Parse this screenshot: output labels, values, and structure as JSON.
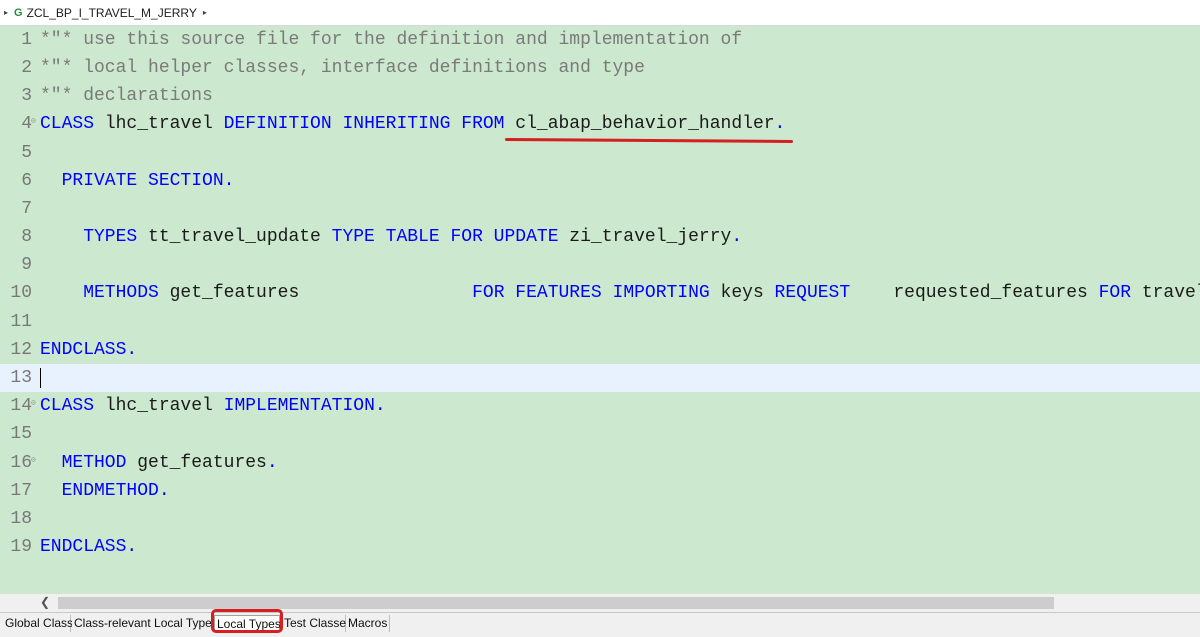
{
  "breadcrumb": {
    "title": "ZCL_BP_I_TRAVEL_M_JERRY",
    "icon": "class-icon"
  },
  "editor": {
    "lines": [
      {
        "n": "1",
        "tokens": [
          {
            "t": "*\"* use this source file for the definition and implementation of",
            "c": "cm"
          }
        ]
      },
      {
        "n": "2",
        "tokens": [
          {
            "t": "*\"* local helper classes, interface definitions and type",
            "c": "cm"
          }
        ]
      },
      {
        "n": "3",
        "tokens": [
          {
            "t": "*\"* declarations",
            "c": "cm"
          }
        ]
      },
      {
        "n": "4",
        "fold": true,
        "tokens": [
          {
            "t": "CLASS",
            "c": "kw"
          },
          {
            "t": " lhc_travel ",
            "c": "id"
          },
          {
            "t": "DEFINITION INHERITING FROM",
            "c": "kw"
          },
          {
            "t": " cl_abap_behavior_handler",
            "c": "id"
          },
          {
            "t": ".",
            "c": "kw"
          }
        ]
      },
      {
        "n": "5",
        "tokens": []
      },
      {
        "n": "6",
        "tokens": [
          {
            "t": "  PRIVATE SECTION.",
            "c": "kw"
          }
        ]
      },
      {
        "n": "7",
        "tokens": []
      },
      {
        "n": "8",
        "tokens": [
          {
            "t": "    TYPES",
            "c": "kw"
          },
          {
            "t": " tt_travel_update ",
            "c": "id"
          },
          {
            "t": "TYPE TABLE FOR UPDATE",
            "c": "kw"
          },
          {
            "t": " zi_travel_jerry",
            "c": "id"
          },
          {
            "t": ".",
            "c": "kw"
          }
        ]
      },
      {
        "n": "9",
        "tokens": []
      },
      {
        "n": "10",
        "tokens": [
          {
            "t": "    METHODS",
            "c": "kw"
          },
          {
            "t": " get_features                ",
            "c": "id"
          },
          {
            "t": "FOR FEATURES IMPORTING",
            "c": "kw"
          },
          {
            "t": " keys ",
            "c": "id"
          },
          {
            "t": "REQUEST",
            "c": "kw"
          },
          {
            "t": "    requested_features ",
            "c": "id"
          },
          {
            "t": "FOR",
            "c": "kw"
          },
          {
            "t": " travel",
            "c": "id"
          }
        ]
      },
      {
        "n": "11",
        "tokens": []
      },
      {
        "n": "12",
        "tokens": [
          {
            "t": "ENDCLASS.",
            "c": "kw"
          }
        ]
      },
      {
        "n": "13",
        "current": true,
        "tokens": []
      },
      {
        "n": "14",
        "fold": true,
        "tokens": [
          {
            "t": "CLASS",
            "c": "kw"
          },
          {
            "t": " lhc_travel ",
            "c": "id"
          },
          {
            "t": "IMPLEMENTATION.",
            "c": "kw"
          }
        ]
      },
      {
        "n": "15",
        "tokens": []
      },
      {
        "n": "16",
        "fold": true,
        "tokens": [
          {
            "t": "  METHOD",
            "c": "kw"
          },
          {
            "t": " get_features",
            "c": "id"
          },
          {
            "t": ".",
            "c": "kw"
          }
        ]
      },
      {
        "n": "17",
        "tokens": [
          {
            "t": "  ENDMETHOD.",
            "c": "kw"
          }
        ]
      },
      {
        "n": "18",
        "tokens": []
      },
      {
        "n": "19",
        "tokens": [
          {
            "t": "ENDCLASS.",
            "c": "kw"
          }
        ]
      }
    ]
  },
  "tabs": [
    {
      "label": "Global Class",
      "active": false
    },
    {
      "label": "Class-relevant Local Types",
      "active": false
    },
    {
      "label": "Local Types",
      "active": true,
      "highlighted": true
    },
    {
      "label": "Test Classes",
      "active": false
    },
    {
      "label": "Macros",
      "active": false
    }
  ],
  "colors": {
    "editor_bg": "#cce8cf",
    "keyword": "#0000ff",
    "comment": "#7a7a7a",
    "highlight": "#d42020",
    "current_line": "#e8f2fe"
  }
}
